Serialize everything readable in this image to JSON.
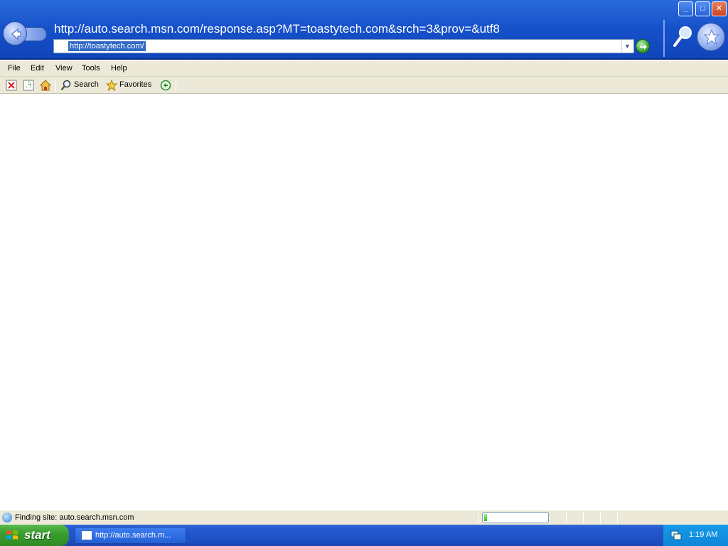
{
  "window": {
    "page_url_title": "http://auto.search.msn.com/response.asp?MT=toastytech.com&srch=3&prov=&utf8",
    "address_value": "http://toastytech.com/",
    "controls": {
      "minimize": "_",
      "maximize": "□",
      "close": "✕"
    }
  },
  "menu": [
    "File",
    "Edit",
    "View",
    "Tools",
    "Help"
  ],
  "toolbar": {
    "search_label": "Search",
    "favorites_label": "Favorites"
  },
  "status": {
    "text": "Finding site: auto.search.msn.com",
    "progress_fraction": 0.05
  },
  "taskbar": {
    "start_label": "start",
    "task_label": "http://auto.search.m...",
    "clock": "1:19 AM"
  },
  "colors": {
    "title_blue": "#1650c9",
    "chrome_beige": "#ece9d8",
    "start_green": "#3a9e2e",
    "tray_blue": "#0f86d8"
  },
  "icons": [
    "back-icon",
    "go-icon",
    "search-icon",
    "favorites-icon",
    "stop-icon",
    "refresh-icon",
    "home-icon",
    "media-icon",
    "globe-icon",
    "windows-logo-icon"
  ]
}
